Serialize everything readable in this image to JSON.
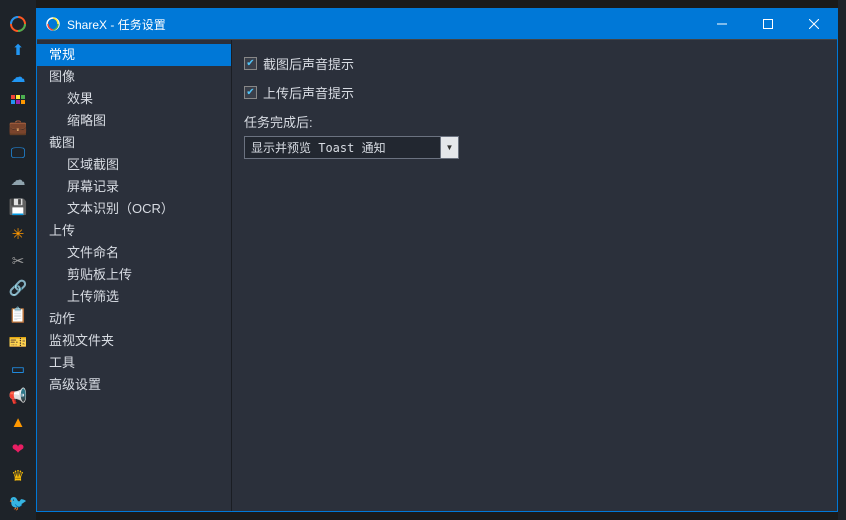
{
  "titlebar": {
    "app": "ShareX",
    "title": "任务设置"
  },
  "tree": {
    "items": [
      {
        "label": "常规",
        "level": 0,
        "selected": true
      },
      {
        "label": "图像",
        "level": 0
      },
      {
        "label": "效果",
        "level": 1
      },
      {
        "label": "缩略图",
        "level": 1
      },
      {
        "label": "截图",
        "level": 0
      },
      {
        "label": "区域截图",
        "level": 1
      },
      {
        "label": "屏幕记录",
        "level": 1
      },
      {
        "label": "文本识别（OCR）",
        "level": 1
      },
      {
        "label": "上传",
        "level": 0
      },
      {
        "label": "文件命名",
        "level": 1
      },
      {
        "label": "剪贴板上传",
        "level": 1
      },
      {
        "label": "上传筛选",
        "level": 1
      },
      {
        "label": "动作",
        "level": 0
      },
      {
        "label": "监视文件夹",
        "level": 0
      },
      {
        "label": "工具",
        "level": 0
      },
      {
        "label": "高级设置",
        "level": 0
      }
    ]
  },
  "main": {
    "checkbox1": {
      "label": "截图后声音提示",
      "checked": true
    },
    "checkbox2": {
      "label": "上传后声音提示",
      "checked": true
    },
    "after_task_label": "任务完成后:",
    "dropdown_value": "显示并预览 Toast 通知"
  },
  "toolbar_icons": [
    "sharex-logo",
    "capture-icon",
    "upload-icon",
    "grid-icon",
    "briefcase-icon",
    "screen-icon",
    "cloud-icon",
    "drive-icon",
    "settings-icon",
    "tools-icon",
    "link-icon",
    "browser-icon",
    "ticket-icon",
    "window-icon",
    "megaphone-icon",
    "cone-icon",
    "heart-icon",
    "crown-icon",
    "twitter-icon"
  ]
}
